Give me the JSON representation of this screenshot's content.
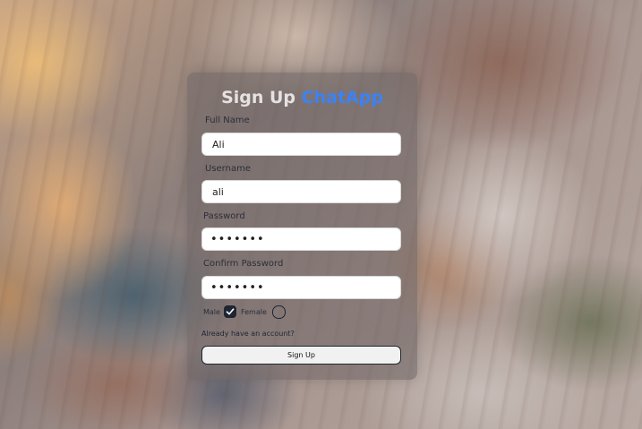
{
  "form": {
    "title": "Sign Up",
    "brand": "ChatApp",
    "fields": [
      {
        "label": "Full Name",
        "value": "Ali"
      },
      {
        "label": "Username",
        "value": "ali"
      },
      {
        "label": "Password",
        "value": "•••••••"
      },
      {
        "label": "Confirm Password",
        "value": "•••••••"
      }
    ],
    "gender": {
      "male_label": "Male",
      "female_label": "Female",
      "selected": "Male"
    },
    "login_link": "Already have an account?",
    "submit_label": "Sign Up"
  },
  "colors": {
    "brand": "#3b82f6",
    "title": "#e6e2e2",
    "card": "#6e6464"
  },
  "icons": {
    "checked": "checkmark-icon"
  }
}
